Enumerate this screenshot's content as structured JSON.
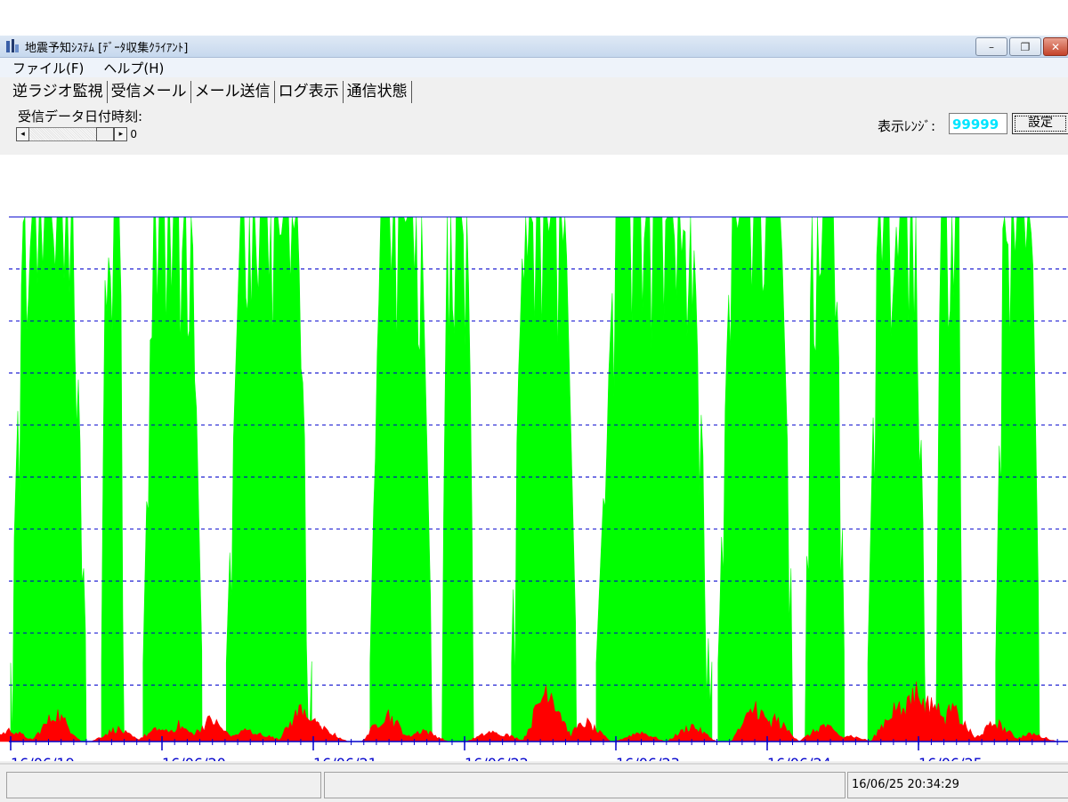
{
  "window": {
    "title": "地震予知ｼｽﾃﾑ [ﾃﾞｰﾀ収集ｸﾗｲｱﾝﾄ]",
    "minimize_label": "–",
    "restore_label": "❐",
    "close_label": "✕"
  },
  "menu": {
    "items": [
      "ファイル(F)",
      "ヘルプ(H)"
    ]
  },
  "tabs": [
    "逆ラジオ監視",
    "受信メール",
    "メール送信",
    "ログ表示",
    "通信状態"
  ],
  "controls": {
    "recv_date_label": "受信データ日付時刻:",
    "scroll_left": "◂",
    "scroll_right": "▸",
    "scroll_value": "0",
    "range_label": "表示ﾚﾝｼﾞ:",
    "range_value": "99999",
    "set_button": "設定"
  },
  "chart_data": {
    "type": "area",
    "x_tick_labels": [
      "16/06/19",
      "16/06/20",
      "16/06/21",
      "16/06/22",
      "16/06/23",
      "16/06/24",
      "16/06/25"
    ],
    "grid": "dashed horizontal",
    "colors": {
      "series_green": "#00ff00",
      "series_red": "#ff0000",
      "grid": "#0000cc",
      "axis_label": "#0000cc"
    },
    "green_active_day_ranges": [
      [
        0.0,
        1.0
      ],
      [
        1.2,
        1.5
      ],
      [
        1.75,
        2.53
      ],
      [
        2.85,
        3.98
      ],
      [
        4.75,
        5.57
      ],
      [
        5.7,
        6.12
      ],
      [
        6.62,
        7.48
      ],
      [
        7.74,
        9.27
      ],
      [
        9.35,
        10.35
      ],
      [
        10.5,
        11.02
      ],
      [
        11.33,
        12.1
      ],
      [
        12.23,
        12.6
      ],
      [
        13.02,
        13.6
      ],
      [
        14.22,
        14.48
      ],
      [
        14.52,
        14.98
      ],
      [
        15.26,
        16.4
      ],
      [
        16.86,
        17.82
      ],
      [
        18.2,
        18.57
      ],
      [
        18.63,
        19.15
      ],
      [
        19.6,
        20.0
      ]
    ],
    "red_peak_days": [
      [
        0.0,
        0.18
      ],
      [
        0.6,
        0.45
      ],
      [
        1.4,
        0.2
      ],
      [
        1.96,
        0.2
      ],
      [
        2.22,
        0.25
      ],
      [
        2.65,
        0.35
      ],
      [
        3.12,
        0.18
      ],
      [
        3.3,
        0.12
      ],
      [
        3.86,
        0.55
      ],
      [
        4.0,
        0.3
      ],
      [
        4.12,
        0.2
      ],
      [
        4.97,
        0.45
      ],
      [
        5.45,
        0.18
      ],
      [
        6.35,
        0.15
      ],
      [
        6.5,
        0.12
      ],
      [
        7.1,
        0.9
      ],
      [
        7.6,
        0.3
      ],
      [
        8.32,
        0.15
      ],
      [
        9.0,
        0.25
      ],
      [
        9.85,
        0.55
      ],
      [
        10.1,
        0.35
      ],
      [
        10.75,
        0.25
      ],
      [
        11.06,
        0.1
      ],
      [
        11.7,
        0.55
      ],
      [
        11.97,
        0.8
      ],
      [
        12.17,
        0.65
      ],
      [
        12.45,
        0.5
      ],
      [
        13.02,
        0.3
      ],
      [
        13.5,
        0.12
      ],
      [
        14.9,
        0.25
      ],
      [
        15.1,
        0.15
      ],
      [
        15.6,
        0.45
      ],
      [
        15.8,
        0.35
      ],
      [
        16.05,
        0.3
      ],
      [
        16.2,
        0.45
      ],
      [
        16.55,
        0.65
      ],
      [
        17.05,
        0.5
      ],
      [
        17.25,
        0.4
      ],
      [
        17.6,
        0.25
      ],
      [
        18.3,
        0.12
      ],
      [
        19.55,
        0.15
      ],
      [
        19.9,
        0.2
      ]
    ]
  },
  "status": {
    "pane1": "",
    "pane2": "",
    "datetime": "16/06/25 20:34:29"
  }
}
